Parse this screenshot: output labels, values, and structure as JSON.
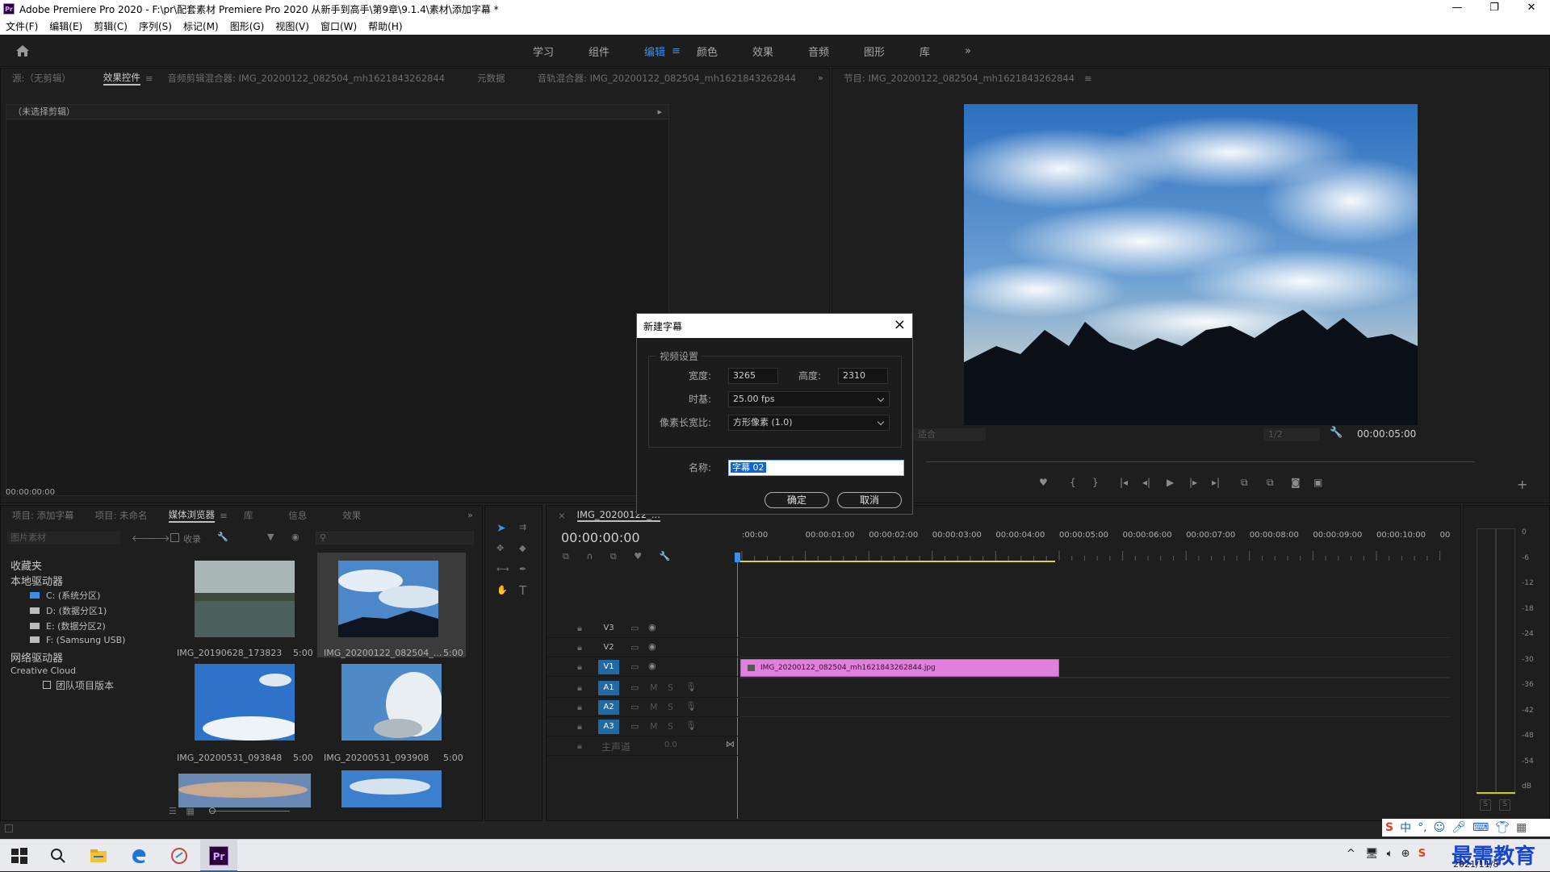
{
  "window": {
    "title": "Adobe Premiere Pro 2020 - F:\\pr\\配套素材 Premiere Pro 2020 从新手到高手\\第9章\\9.1.4\\素材\\添加字幕 *",
    "min": "—",
    "max": "❐",
    "close": "✕",
    "app_icon": "Pr"
  },
  "menu": [
    "文件(F)",
    "编辑(E)",
    "剪辑(C)",
    "序列(S)",
    "标记(M)",
    "图形(G)",
    "视图(V)",
    "窗口(W)",
    "帮助(H)"
  ],
  "workspaces": [
    "学习",
    "组件",
    "编辑",
    "颜色",
    "效果",
    "音频",
    "图形",
    "库"
  ],
  "workspace_active_index": 2,
  "workspace_more": "»",
  "source_panel": {
    "tabs": [
      "源:（无剪辑）",
      "效果控件",
      "音频剪辑混合器: IMG_20200122_082504_mh1621843262844",
      "元数据",
      "音轨混合器: IMG_20200122_082504_mh1621843262844"
    ],
    "active_tab_index": 1,
    "menu_glyph": "≡",
    "more": "»",
    "no_clip": "（未选择剪辑）",
    "timecode": "00:00:00:00"
  },
  "program_panel": {
    "tab": "节目: IMG_20200122_082504_mh1621843262844",
    "menu_glyph": "≡",
    "fit": "适合",
    "resolution": "1/2",
    "timecode": "00:00:05:00",
    "add": "+"
  },
  "project_panel": {
    "tabs": [
      "项目: 添加字幕",
      "项目: 未命名",
      "媒体浏览器",
      "库",
      "信息",
      "效果"
    ],
    "active_tab_index": 2,
    "more": "»",
    "folder": "图片素材",
    "favorites_checkbox": "收录",
    "tree": [
      {
        "label": "收藏夹",
        "level": 0
      },
      {
        "label": "本地驱动器",
        "level": 0
      },
      {
        "label": "C: (系统分区)",
        "level": 1
      },
      {
        "label": "D: (数据分区1)",
        "level": 1
      },
      {
        "label": "E: (数据分区2)",
        "level": 1
      },
      {
        "label": "F: (Samsung USB)",
        "level": 1
      },
      {
        "label": "网络驱动器",
        "level": 0
      },
      {
        "label": "Creative Cloud",
        "level": 0
      },
      {
        "label": "团队项目版本",
        "level": 1
      }
    ],
    "thumbs": [
      {
        "name": "IMG_20190628_173823",
        "dur": "5:00",
        "kind": "lake"
      },
      {
        "name": "IMG_20200122_082504_...",
        "dur": "5:00",
        "kind": "sky",
        "selected": true
      },
      {
        "name": "IMG_20200531_093848",
        "dur": "5:00",
        "kind": "blue"
      },
      {
        "name": "IMG_20200531_093908",
        "dur": "5:00",
        "kind": "cloud"
      },
      {
        "name": "",
        "dur": "",
        "kind": "dusk"
      },
      {
        "name": "",
        "dur": "",
        "kind": "blue2"
      }
    ]
  },
  "timeline": {
    "tab": "IMG_20200122_...",
    "timecode": "00:00:00:00",
    "ruler": [
      ":00:00",
      "00:00:01:00",
      "00:00:02:00",
      "00:00:03:00",
      "00:00:04:00",
      "00:00:05:00",
      "00:00:06:00",
      "00:00:07:00",
      "00:00:08:00",
      "00:00:09:00",
      "00:00:10:00",
      "00:00:1"
    ],
    "video_tracks": [
      "V3",
      "V2",
      "V1"
    ],
    "audio_tracks": [
      "A1",
      "A2",
      "A3"
    ],
    "master": "主声道",
    "master_val": "0.0",
    "clip": "IMG_20200122_082504_mh1621843262844.jpg",
    "clip_end_sec": 5,
    "mute": "M",
    "solo": "S"
  },
  "meter": {
    "scale": [
      "0",
      "-6",
      "-12",
      "-18",
      "-24",
      "-30",
      "-36",
      "-42",
      "-48",
      "-54",
      "dB"
    ],
    "s_buttons": [
      "S",
      "S"
    ]
  },
  "dialog": {
    "title": "新建字幕",
    "group": "视频设置",
    "width_label": "宽度:",
    "width": "3265",
    "height_label": "高度:",
    "height": "2310",
    "timebase_label": "时基:",
    "timebase": "25.00 fps",
    "par_label": "像素长宽比:",
    "par": "方形像素 (1.0)",
    "name_label": "名称:",
    "name": "字幕 02",
    "ok": "确定",
    "cancel": "取消"
  },
  "taskbar": {
    "ime": "中",
    "date": "2021/11/8",
    "watermark": "最需教育"
  },
  "colors": {
    "accent": "#3d8ee6",
    "clip": "#e07fdc",
    "track_on": "#1f6aa5"
  }
}
